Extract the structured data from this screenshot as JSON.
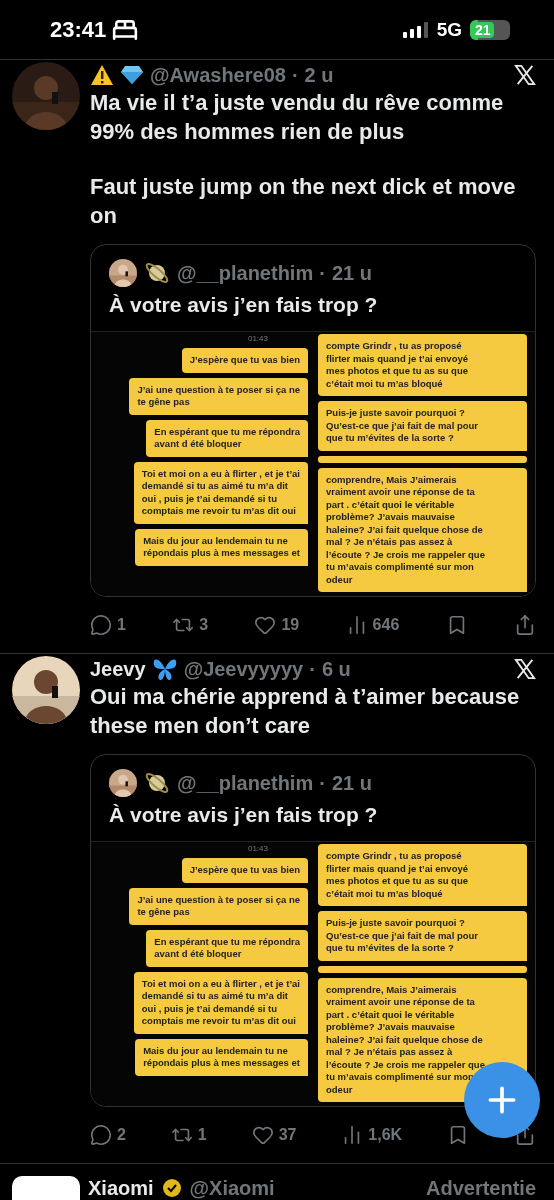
{
  "status_bar": {
    "time": "23:41",
    "network": "5G",
    "battery": "21"
  },
  "posts": [
    {
      "badges": [
        {
          "kind": "warning"
        },
        {
          "kind": "diamond"
        }
      ],
      "handle": "@Awashere08",
      "separator": "·",
      "time": "2 u",
      "paragraphs": [
        "Ma vie il t’a juste vendu du rêve comme 99% des hommes rien de plus",
        "Faut juste jump on the next dick et move on"
      ],
      "quote": {
        "badges": [
          {
            "kind": "planet"
          }
        ],
        "handle": "@__planethim",
        "separator": "·",
        "time": "21 u",
        "text": "À votre avis j’en fais trop ?",
        "chat": {
          "time": "01:43",
          "left": [
            {
              "kind": "text",
              "text": "J’espère que tu vas bien"
            },
            {
              "kind": "text",
              "text": "J’ai une question à te poser si ça ne\nte gêne pas"
            },
            {
              "kind": "text",
              "text": "En espérant que tu me répondra\navant d été bloquer"
            },
            {
              "kind": "text",
              "text": "Toi et moi on a eu à flirter , et je t’ai\ndemandé si tu as aimé tu m’a dit\noui , puis je t’ai demandé si tu\ncomptais me revoir tu m’as dit oui"
            },
            {
              "kind": "text",
              "text": "Mais du jour au lendemain tu ne\nrépondais plus à mes messages et"
            }
          ],
          "right": [
            {
              "kind": "text",
              "text": "compte Grindr , tu as proposé\nflirter mais quand je t’ai envoyé\nmes photos et que tu as su que\nc’était moi tu m’as bloqué"
            },
            {
              "kind": "text",
              "text": "Puis-je juste savoir pourquoi ?\nQu’est-ce que j’ai fait de mal pour\nque tu m’évites de la sorte ?"
            },
            {
              "kind": "strip"
            },
            {
              "kind": "text",
              "text": "comprendre, Mais J’aimerais\nvraiment avoir une réponse de ta\npart . c’était quoi le véritable\nproblème? J’avais mauvaise\nhaleine? J’ai fait quelque chose de\nmal ? Je n’étais pas assez à\nl’écoute ? Je crois me rappeler que\ntu m’avais complimenté sur mon\nodeur"
            }
          ]
        }
      },
      "actions": [
        {
          "kind": "reply",
          "count": "1"
        },
        {
          "kind": "repost",
          "count": "3"
        },
        {
          "kind": "like",
          "count": "19"
        },
        {
          "kind": "views",
          "count": "646"
        },
        {
          "kind": "bookmark"
        },
        {
          "kind": "share"
        }
      ]
    },
    {
      "name": "Jeevy",
      "badges": [
        {
          "kind": "butterfly"
        }
      ],
      "handle": "@Jeevyyyyy",
      "separator": "·",
      "time": "6 u",
      "paragraphs": [
        "Oui ma chérie apprend à t’aimer because these men don’t care"
      ],
      "quote": {
        "badges": [
          {
            "kind": "planet"
          }
        ],
        "handle": "@__planethim",
        "separator": "·",
        "time": "21 u",
        "text": "À votre avis j’en fais trop ?",
        "chat": {
          "time": "01:43",
          "left": [
            {
              "kind": "text",
              "text": "J’espère que tu vas bien"
            },
            {
              "kind": "text",
              "text": "J’ai une question à te poser si ça ne\nte gêne pas"
            },
            {
              "kind": "text",
              "text": "En espérant que tu me répondra\navant d été bloquer"
            },
            {
              "kind": "text",
              "text": "Toi et moi on a eu à flirter , et je t’ai\ndemandé si tu as aimé tu m’a dit\noui , puis je t’ai demandé si tu\ncomptais me revoir tu m’as dit oui"
            },
            {
              "kind": "text",
              "text": "Mais du jour au lendemain tu ne\nrépondais plus à mes messages et"
            }
          ],
          "right": [
            {
              "kind": "text",
              "text": "compte Grindr , tu as proposé\nflirter mais quand je t’ai envoyé\nmes photos et que tu as su que\nc’était moi tu m’as bloqué"
            },
            {
              "kind": "text",
              "text": "Puis-je juste savoir pourquoi ?\nQu’est-ce que j’ai fait de mal pour\nque tu m’évites de la sorte ?"
            },
            {
              "kind": "strip"
            },
            {
              "kind": "text",
              "text": "comprendre, Mais J’aimerais\nvraiment avoir une réponse de ta\npart . c’était quoi le véritable\nproblème? J’avais mauvaise\nhaleine? J’ai fait quelque chose de\nmal ? Je n’étais pas assez à\nl’écoute ? Je crois me rappeler que\ntu m’avais complimenté sur mon\nodeur"
            }
          ]
        }
      },
      "actions": [
        {
          "kind": "reply",
          "count": "2"
        },
        {
          "kind": "repost",
          "count": "1"
        },
        {
          "kind": "like",
          "count": "37"
        },
        {
          "kind": "views",
          "count": "1,6K"
        },
        {
          "kind": "bookmark"
        },
        {
          "kind": "share"
        }
      ]
    }
  ],
  "ad": {
    "name": "Xiaomi",
    "handle": "@Xiaomi",
    "label": "Advertentie"
  }
}
